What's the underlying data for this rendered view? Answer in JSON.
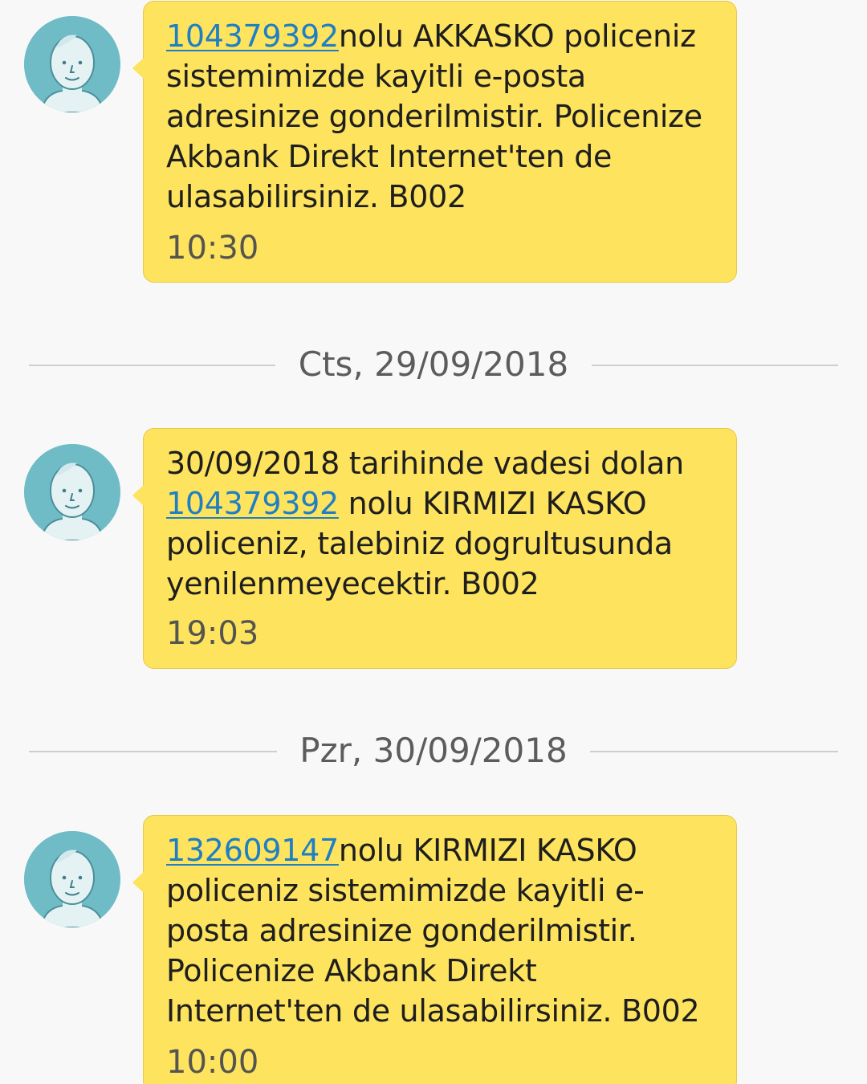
{
  "messages": [
    {
      "link": "104379392",
      "text_rest": "nolu AKKASKO policeniz sistemimizde kayitli e-posta adresinize gonderilmistir. Policenize Akbank Direkt Internet'ten de ulasabilirsiniz. B002",
      "time": "10:30"
    },
    {
      "text_before": "30/09/2018 tarihinde vadesi dolan",
      "link": "104379392",
      "text_rest": " nolu KIRMIZI KASKO policeniz, talebiniz dogrultusunda yenilenmeyecektir. B002",
      "time": "19:03"
    },
    {
      "link": "132609147",
      "text_rest": "nolu KIRMIZI KASKO policeniz sistemimizde kayitli e-posta adresinize gonderilmistir. Policenize Akbank Direkt Internet'ten de ulasabilirsiniz. B002",
      "time": "10:00"
    }
  ],
  "dividers": [
    {
      "label": "Cts, 29/09/2018"
    },
    {
      "label": "Pzr, 30/09/2018"
    }
  ],
  "icons": {
    "avatar": "default-contact-avatar-icon"
  },
  "colors": {
    "bubble": "#fde35e",
    "link": "#1f7fc4",
    "avatar_bg": "#6fbcc7",
    "background": "#f8f8f8"
  }
}
